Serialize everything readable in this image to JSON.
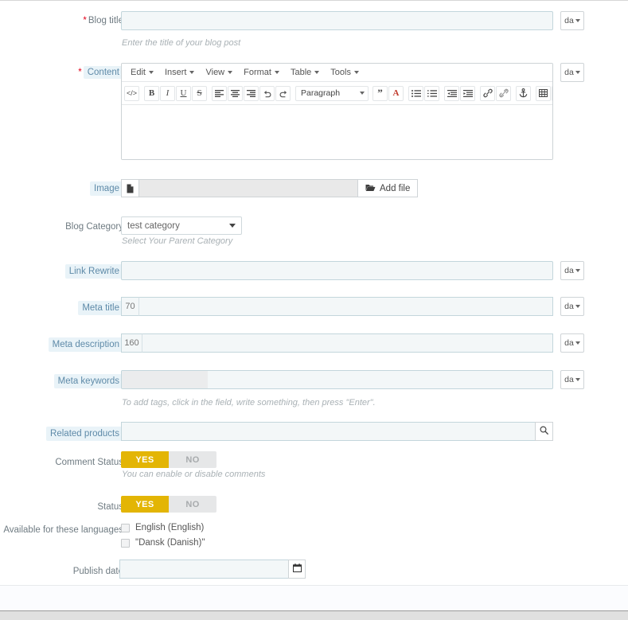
{
  "form": {
    "blog_title": {
      "label": "Blog title",
      "required": true,
      "value": "",
      "placeholder": "",
      "help": "Enter the title of your blog post",
      "lang": "da"
    },
    "content": {
      "label": "Content",
      "required": true,
      "lang": "da",
      "value": "",
      "menubar": [
        "Edit",
        "Insert",
        "View",
        "Format",
        "Table",
        "Tools"
      ],
      "format_select": "Paragraph",
      "toolbar_icons": [
        "source-code-icon",
        "bold-icon",
        "italic-icon",
        "underline-icon",
        "strikethrough-icon",
        "align-left-icon",
        "align-center-icon",
        "align-right-icon",
        "undo-icon",
        "redo-icon",
        "blockquote-icon",
        "text-color-icon",
        "bullet-list-icon",
        "numbered-list-icon",
        "outdent-icon",
        "indent-icon",
        "link-icon",
        "unlink-icon",
        "anchor-icon",
        "table-icon",
        "image-icon"
      ]
    },
    "image": {
      "label": "Image",
      "file_value": "",
      "add_file_label": "Add file",
      "file_icon": "file-icon",
      "folder_icon": "folder-open-icon"
    },
    "blog_category": {
      "label": "Blog Category",
      "selected": "test category",
      "options": [
        "test category"
      ],
      "help": "Select Your Parent Category"
    },
    "link_rewrite": {
      "label": "Link Rewrite",
      "value": "",
      "lang": "da"
    },
    "meta_title": {
      "label": "Meta title",
      "counter": "70",
      "value": "",
      "lang": "da"
    },
    "meta_description": {
      "label": "Meta description",
      "counter": "160",
      "value": "",
      "lang": "da"
    },
    "meta_keywords": {
      "label": "Meta keywords",
      "value": "",
      "lang": "da",
      "help": "To add tags, click in the field, write something, then press \"Enter\"."
    },
    "related_products": {
      "label": "Related products",
      "value": "",
      "search_icon": "search-icon"
    },
    "comment_status": {
      "label": "Comment Status",
      "yes": "YES",
      "no": "NO",
      "state": "yes",
      "help": "You can enable or disable comments"
    },
    "status": {
      "label": "Status",
      "yes": "YES",
      "no": "NO",
      "state": "yes"
    },
    "languages": {
      "label": "Available for these languages",
      "items": [
        {
          "label": "English (English)",
          "checked": false
        },
        {
          "label": "\"Dansk (Danish)\"",
          "checked": false
        }
      ]
    },
    "publish_date": {
      "label": "Publish date",
      "value": "",
      "calendar_icon": "calendar-icon"
    }
  },
  "colors": {
    "toggle_on": "#e3b505",
    "toggle_off": "#e6e7e8",
    "input_bg": "#f3f7f8",
    "input_border": "#c3d6dc",
    "tip_label_bg": "#e9f3f8",
    "tip_label_text": "#5e8aa8",
    "required_star": "#e2001a"
  }
}
